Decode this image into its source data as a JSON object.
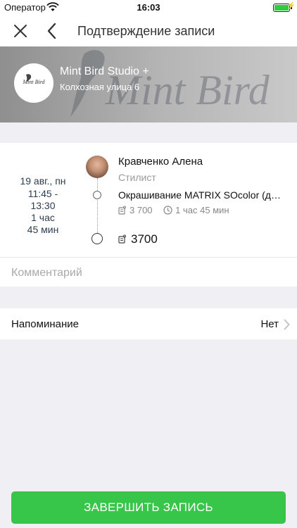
{
  "status_bar": {
    "carrier": "Оператор",
    "time": "16:03"
  },
  "nav": {
    "title": "Подтверждение записи"
  },
  "studio": {
    "name": "Mint Bird Studio +",
    "address": "Колхозная улица 6",
    "logo_text": "Mint Bird",
    "watermark": "Mint Bird"
  },
  "appointment": {
    "date": "19 авг., пн",
    "time_start": "11:45 -",
    "time_end": "13:30",
    "duration_1": "1 час",
    "duration_2": "45 мин",
    "master_name": "Кравченко Алена",
    "master_role": "Стилист",
    "service": "Окрашивание MATRIX SOcolor (д…",
    "price": "3 700",
    "service_duration": "1 час 45 мин",
    "total": "3700"
  },
  "comment": {
    "placeholder": "Комментарий"
  },
  "reminder": {
    "label": "Напоминание",
    "value": "Нет"
  },
  "actions": {
    "finish_label": "ЗАВЕРШИТЬ ЗАПИСЬ"
  },
  "colors": {
    "accent_green": "#37c54a",
    "battery_green": "#2ecc40"
  },
  "icons": [
    "wifi-icon",
    "battery-icon",
    "close-icon",
    "back-icon",
    "price-tag-icon",
    "clock-icon",
    "chevron-right-icon"
  ]
}
